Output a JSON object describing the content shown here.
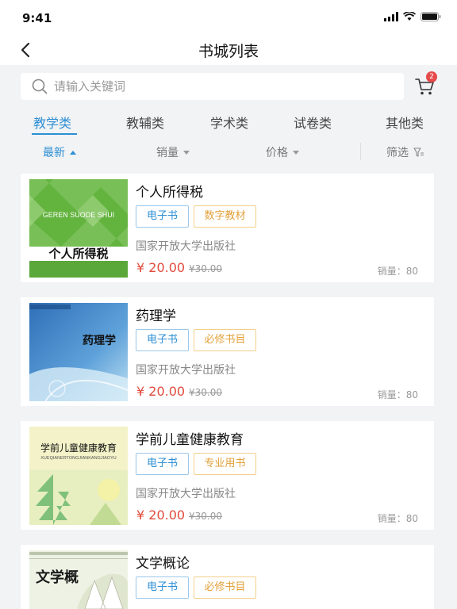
{
  "status_bar": {
    "time": "9:41"
  },
  "nav": {
    "title": "书城列表"
  },
  "search": {
    "placeholder": "请输入关键词",
    "cart_badge": "2"
  },
  "tabs": [
    {
      "label": "教学类",
      "active": true
    },
    {
      "label": "教辅类",
      "active": false
    },
    {
      "label": "学术类",
      "active": false
    },
    {
      "label": "试卷类",
      "active": false
    },
    {
      "label": "其他类",
      "active": false
    }
  ],
  "sort": [
    {
      "label": "最新",
      "active": true,
      "direction": "up"
    },
    {
      "label": "销量",
      "active": false,
      "direction": "down"
    },
    {
      "label": "价格",
      "active": false,
      "direction": "down"
    }
  ],
  "filter_label": "筛选",
  "books": [
    {
      "title": "个人所得税",
      "cover_text": "个人所得税",
      "cover_subtext": "GEREN SUODE SHUI",
      "tags": [
        "电子书",
        "数字教材"
      ],
      "publisher": "国家开放大学出版社",
      "price": "¥ 20.00",
      "old_price": "¥30.00",
      "sales": "销量：80"
    },
    {
      "title": "药理学",
      "cover_text": "药理学",
      "tags": [
        "电子书",
        "必修书目"
      ],
      "publisher": "国家开放大学出版社",
      "price": "¥ 20.00",
      "old_price": "¥30.00",
      "sales": "销量：80"
    },
    {
      "title": "学前儿童健康教育",
      "cover_text": "学前儿童健康教育",
      "cover_subtext": "XUEQIANERTONGJIANKANGJIAOYU",
      "tags": [
        "电子书",
        "专业用书"
      ],
      "publisher": "国家开放大学出版社",
      "price": "¥ 20.00",
      "old_price": "¥30.00",
      "sales": "销量：80"
    },
    {
      "title": "文学概论",
      "cover_text": "文学概",
      "tags": [
        "电子书",
        "必修书目"
      ]
    }
  ],
  "colors": {
    "accent": "#2d8fd5",
    "price": "#e04a3c",
    "badge": "#e64a4a",
    "tag_orange": "#e2a13a"
  }
}
